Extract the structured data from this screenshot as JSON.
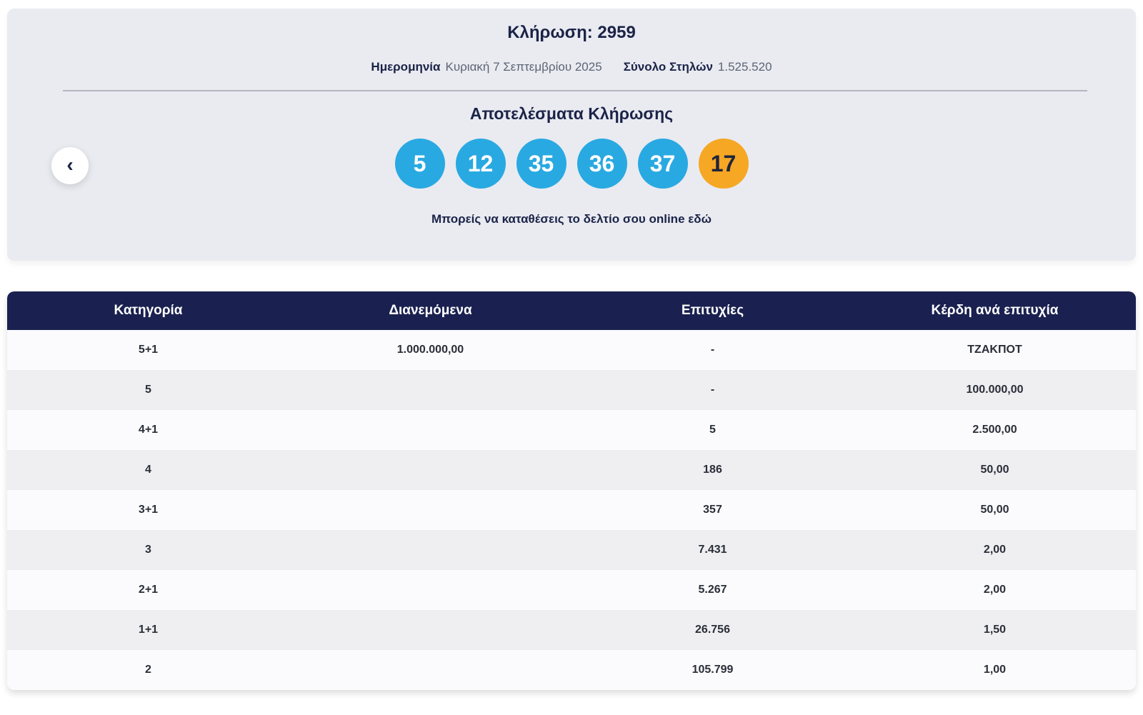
{
  "banner": {
    "title_label": "Κλήρωση:",
    "title_number": "2959",
    "date_label": "Ημερομηνία",
    "date_value": "Κυριακή 7 Σεπτεμβρίου 2025",
    "columns_label": "Σύνολο Στηλών",
    "columns_value": "1.525.520",
    "results_title": "Αποτελέσματα Κλήρωσης",
    "numbers": [
      "5",
      "12",
      "35",
      "36",
      "37"
    ],
    "joker_number": "17",
    "note": "Μπορείς να καταθέσεις το δελτίο σου online εδώ"
  },
  "icons": {
    "chevron_left": "‹"
  },
  "colors": {
    "ball_blue": "#29a9e1",
    "ball_joker_orange": "#f6a724",
    "table_header_navy": "#1a2150",
    "banner_background": "#e9ebf1",
    "text_navy": "#1b2347"
  },
  "table": {
    "headers": [
      "Κατηγορία",
      "Διανεμόμενα",
      "Επιτυχίες",
      "Κέρδη ανά επιτυχία"
    ],
    "rows": [
      {
        "category": "5+1",
        "distributed": "1.000.000,00",
        "hits": "-",
        "prize": "ΤΖΑΚΠΟΤ"
      },
      {
        "category": "5",
        "distributed": "",
        "hits": "-",
        "prize": "100.000,00"
      },
      {
        "category": "4+1",
        "distributed": "",
        "hits": "5",
        "prize": "2.500,00"
      },
      {
        "category": "4",
        "distributed": "",
        "hits": "186",
        "prize": "50,00"
      },
      {
        "category": "3+1",
        "distributed": "",
        "hits": "357",
        "prize": "50,00"
      },
      {
        "category": "3",
        "distributed": "",
        "hits": "7.431",
        "prize": "2,00"
      },
      {
        "category": "2+1",
        "distributed": "",
        "hits": "5.267",
        "prize": "2,00"
      },
      {
        "category": "1+1",
        "distributed": "",
        "hits": "26.756",
        "prize": "1,50"
      },
      {
        "category": "2",
        "distributed": "",
        "hits": "105.799",
        "prize": "1,00"
      }
    ]
  }
}
